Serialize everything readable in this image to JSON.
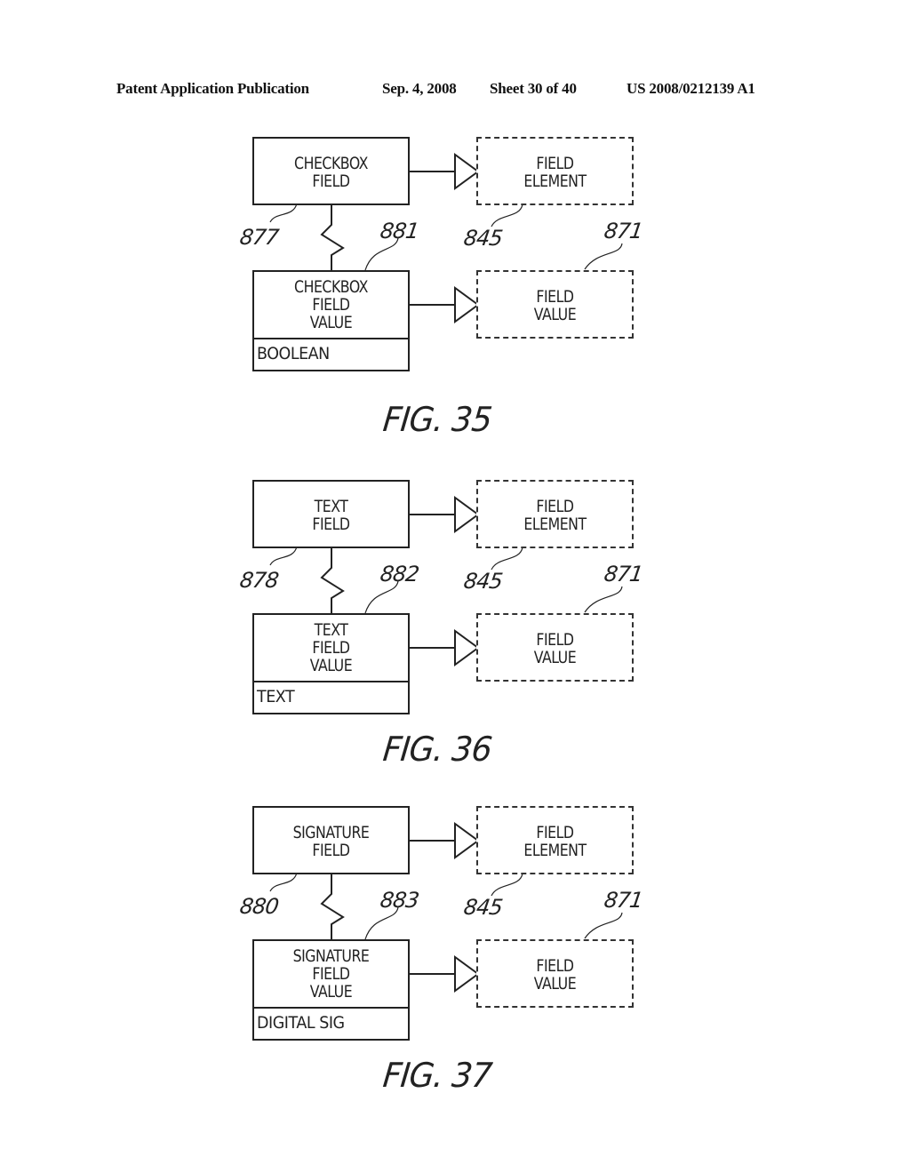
{
  "header": {
    "publication": "Patent Application Publication",
    "date": "Sep. 4, 2008",
    "sheet": "Sheet 30 of 40",
    "number": "US 2008/0212139 A1"
  },
  "figures": [
    {
      "caption": "FIG. 35",
      "field_box": {
        "lines": [
          "CHECKBOX",
          "FIELD"
        ],
        "ref": "877"
      },
      "value_box": {
        "lines": [
          "CHECKBOX",
          "FIELD",
          "VALUE"
        ],
        "type": "BOOLEAN",
        "ref": "881"
      },
      "element_box": {
        "lines": [
          "FIELD",
          "ELEMENT"
        ],
        "ref": "845"
      },
      "parent_value_box": {
        "lines": [
          "FIELD",
          "VALUE"
        ],
        "ref": "871"
      }
    },
    {
      "caption": "FIG. 36",
      "field_box": {
        "lines": [
          "TEXT",
          "FIELD"
        ],
        "ref": "878"
      },
      "value_box": {
        "lines": [
          "TEXT",
          "FIELD",
          "VALUE"
        ],
        "type": "TEXT",
        "ref": "882"
      },
      "element_box": {
        "lines": [
          "FIELD",
          "ELEMENT"
        ],
        "ref": "845"
      },
      "parent_value_box": {
        "lines": [
          "FIELD",
          "VALUE"
        ],
        "ref": "871"
      }
    },
    {
      "caption": "FIG. 37",
      "field_box": {
        "lines": [
          "SIGNATURE",
          "FIELD"
        ],
        "ref": "880"
      },
      "value_box": {
        "lines": [
          "SIGNATURE",
          "FIELD",
          "VALUE"
        ],
        "type": "DIGITAL SIG",
        "ref": "883"
      },
      "element_box": {
        "lines": [
          "FIELD",
          "ELEMENT"
        ],
        "ref": "845"
      },
      "parent_value_box": {
        "lines": [
          "FIELD",
          "VALUE"
        ],
        "ref": "871"
      }
    }
  ]
}
